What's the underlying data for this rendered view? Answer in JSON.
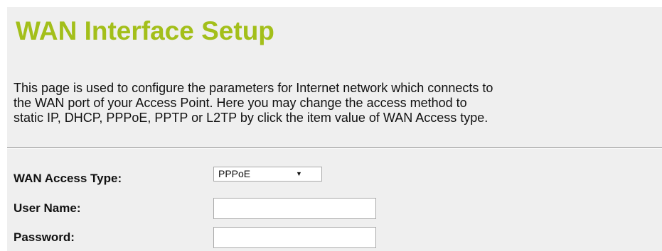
{
  "page": {
    "title": "WAN Interface Setup",
    "description_lines": [
      "This page is used to configure the parameters for Internet network which connects to",
      "the WAN port of your Access Point. Here you may change the access method to",
      "static IP, DHCP, PPPoE, PPTP or L2TP by click the item value of WAN Access type."
    ]
  },
  "form": {
    "wan_access_type": {
      "label": "WAN Access Type:",
      "selected": "PPPoE",
      "arrow_glyph": "▼",
      "icon": "chevron-down-icon"
    },
    "user_name": {
      "label": "User Name:",
      "value": ""
    },
    "password": {
      "label": "Password:",
      "value": ""
    }
  },
  "colors": {
    "title": "#a3bf1a",
    "panel_background": "#efefef",
    "text": "#111111"
  }
}
